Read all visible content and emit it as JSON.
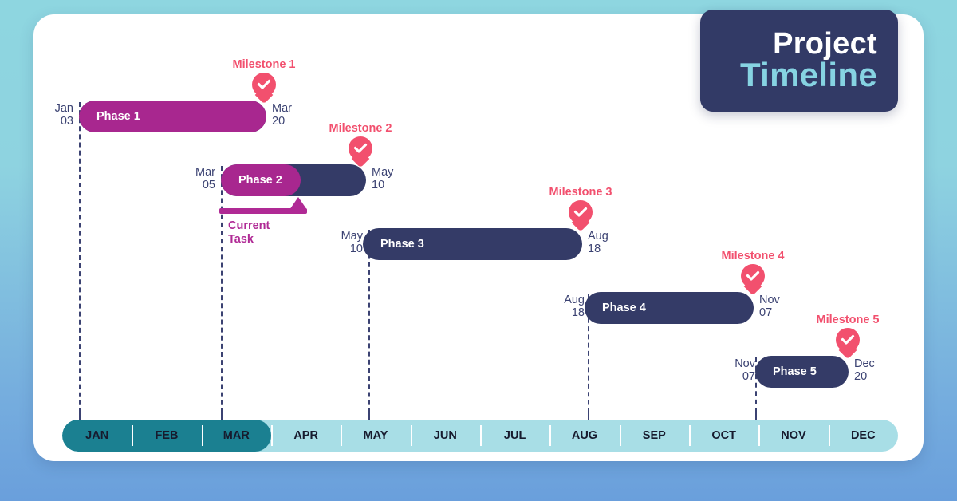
{
  "title": {
    "line1": "Project",
    "line2": "Timeline"
  },
  "axis": {
    "months": [
      "JAN",
      "FEB",
      "MAR",
      "APR",
      "MAY",
      "JUN",
      "JUL",
      "AUG",
      "SEP",
      "OCT",
      "NOV",
      "DEC"
    ],
    "progress_through": "MAR",
    "progress_percent": 25,
    "fill_color": "#1b8091",
    "track_color": "#a8dee6"
  },
  "legend": {
    "current_task_label_line1": "Current",
    "current_task_label_line2": "Task"
  },
  "colors": {
    "phase_bar": "#343b67",
    "phase_progress": "#a8278f",
    "milestone": "#f2506e",
    "card": "#ffffff",
    "title_badge": "#323a66",
    "title_accent": "#86d3e2"
  },
  "chart_data": {
    "type": "bar",
    "title": "Project Timeline",
    "xlabel": "",
    "ylabel": "",
    "categories": [
      "Phase 1",
      "Phase 2",
      "Phase 3",
      "Phase 4",
      "Phase 5"
    ],
    "axis_months": [
      "JAN",
      "FEB",
      "MAR",
      "APR",
      "MAY",
      "JUN",
      "JUL",
      "AUG",
      "SEP",
      "OCT",
      "NOV",
      "DEC"
    ],
    "tasks": [
      {
        "name": "Phase 1",
        "start": "Jan 03",
        "end": "Mar 20",
        "start_month": "Jan",
        "start_day": "03",
        "end_month": "Mar",
        "end_day": "20",
        "progress_percent": 100,
        "milestone": "Milestone 1",
        "milestone_done": true
      },
      {
        "name": "Phase 2",
        "start": "Mar 05",
        "end": "May 10",
        "start_month": "Mar",
        "start_day": "05",
        "end_month": "May",
        "end_day": "10",
        "progress_percent": 55,
        "milestone": "Milestone 2",
        "milestone_done": true,
        "current_task": true
      },
      {
        "name": "Phase 3",
        "start": "May 10",
        "end": "Aug 18",
        "start_month": "May",
        "start_day": "10",
        "end_month": "Aug",
        "end_day": "18",
        "progress_percent": 0,
        "milestone": "Milestone 3",
        "milestone_done": true
      },
      {
        "name": "Phase 4",
        "start": "Aug 18",
        "end": "Nov 07",
        "start_month": "Aug",
        "start_day": "18",
        "end_month": "Nov",
        "end_day": "07",
        "progress_percent": 0,
        "milestone": "Milestone 4",
        "milestone_done": true
      },
      {
        "name": "Phase 5",
        "start": "Nov 07",
        "end": "Dec 20",
        "start_month": "Nov",
        "start_day": "07",
        "end_month": "Dec",
        "end_day": "20",
        "progress_percent": 0,
        "milestone": "Milestone 5",
        "milestone_done": true
      }
    ]
  }
}
